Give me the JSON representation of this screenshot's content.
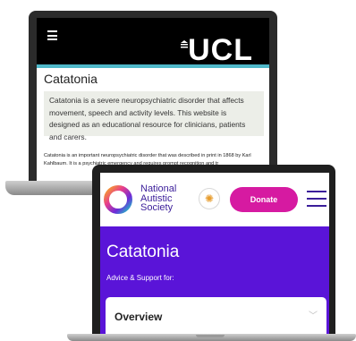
{
  "ucl_site": {
    "logo": "UCL",
    "page_title": "Catatonia",
    "intro": "Catatonia is a severe neuropsychiatric disorder that affects movement, speech and activity levels. This website is designed as an educational resource for clinicians, patients and carers.",
    "body": "Catatonia is an important neuropsychiatric disorder that was described in print in 1868 by Karl Kahlbaum. It is a psychiatric emergency and requires prompt recognition and tr"
  },
  "nas_site": {
    "logo_lines": [
      "National",
      "Autistic",
      "Society"
    ],
    "donate_label": "Donate",
    "page_title": "Catatonia",
    "subtitle": "Advice & Support for:",
    "overview_label": "Overview",
    "colors": {
      "brand_purple": "#5a14d8",
      "donate_pink": "#d61aa1",
      "ucl_accent": "#4fb8c9"
    }
  }
}
